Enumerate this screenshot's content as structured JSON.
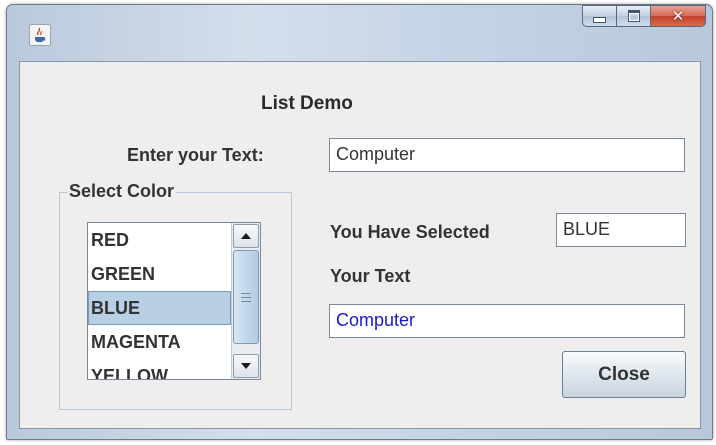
{
  "window": {
    "title_icon": "java-cup-icon",
    "controls": {
      "minimize": "minimize-icon",
      "maximize": "maximize-icon",
      "close": "close-icon"
    }
  },
  "main": {
    "heading": "List Demo",
    "enter_text_label": "Enter your Text:",
    "enter_text_value": "Computer",
    "group_title": "Select Color",
    "color_list": [
      {
        "label": "RED"
      },
      {
        "label": "GREEN"
      },
      {
        "label": "BLUE"
      },
      {
        "label": "MAGENTA"
      },
      {
        "label": "YELLOW"
      }
    ],
    "selected_index": 2,
    "you_have_selected_label": "You Have Selected",
    "you_have_selected_value": "BLUE",
    "your_text_label": "Your Text",
    "your_text_value": "Computer",
    "close_label": "Close"
  },
  "colors": {
    "selection_bg": "#b8cfe5",
    "your_text_color": "#1a1acc",
    "close_button_red": "#c4412c"
  }
}
